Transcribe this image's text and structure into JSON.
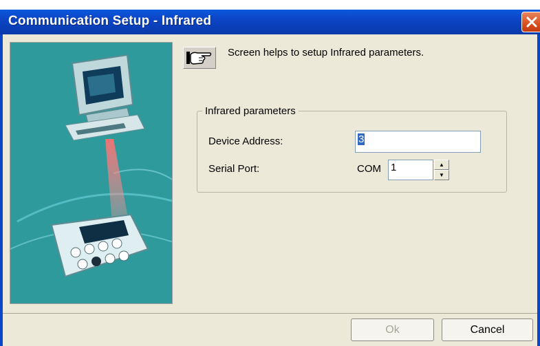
{
  "window": {
    "title": "Communication Setup - Infrared"
  },
  "hint": {
    "icon": "pointing-hand-icon",
    "text": "Screen helps to setup Infrared parameters."
  },
  "infrared_parameters": {
    "group_title": "Infrared parameters",
    "device_address_label": "Device Address:",
    "device_address_value": "3",
    "serial_port_label": "Serial Port:",
    "serial_port_prefix": "COM",
    "serial_port_value": "1"
  },
  "buttons": {
    "ok": "Ok",
    "cancel": "Cancel"
  },
  "colors": {
    "title_bar": "#0c46c8",
    "close_button": "#d9501f",
    "illustration_bg": "#2e9a9c",
    "dialog_bg": "#ece9d8"
  }
}
